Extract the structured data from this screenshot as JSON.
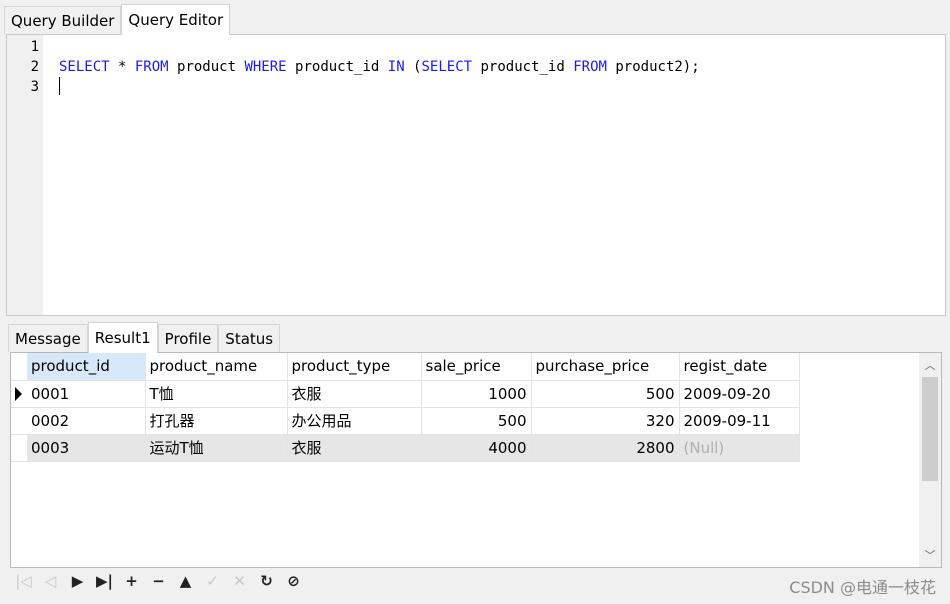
{
  "top_tabs": [
    {
      "label": "Query Builder",
      "active": false
    },
    {
      "label": "Query Editor",
      "active": true
    }
  ],
  "editor": {
    "lines": [
      {
        "num": "1",
        "tokens": []
      },
      {
        "num": "2",
        "tokens": [
          {
            "t": "SELECT",
            "kw": true
          },
          {
            "t": " * "
          },
          {
            "t": "FROM",
            "kw": true
          },
          {
            "t": " product "
          },
          {
            "t": "WHERE",
            "kw": true
          },
          {
            "t": " product_id "
          },
          {
            "t": "IN",
            "kw": true
          },
          {
            "t": " ("
          },
          {
            "t": "SELECT",
            "kw": true
          },
          {
            "t": " product_id "
          },
          {
            "t": "FROM",
            "kw": true
          },
          {
            "t": " product2);"
          }
        ]
      },
      {
        "num": "3",
        "tokens": []
      }
    ]
  },
  "bottom_tabs": [
    {
      "label": "Message",
      "active": false
    },
    {
      "label": "Result1",
      "active": true
    },
    {
      "label": "Profile",
      "active": false
    },
    {
      "label": "Status",
      "active": false
    }
  ],
  "grid": {
    "columns": [
      "product_id",
      "product_name",
      "product_type",
      "sale_price",
      "purchase_price",
      "regist_date"
    ],
    "numeric_columns": [
      3,
      4
    ],
    "selected_header": 0,
    "current_row": 0,
    "highlighted_row": 2,
    "rows": [
      [
        "0001",
        "T恤",
        "衣服",
        "1000",
        "500",
        "2009-09-20"
      ],
      [
        "0002",
        "打孔器",
        "办公用品",
        "500",
        "320",
        "2009-09-11"
      ],
      [
        "0003",
        "运动T恤",
        "衣服",
        "4000",
        "2800",
        "(Null)"
      ]
    ]
  },
  "navbar": [
    {
      "icon": "first-record-icon",
      "glyph": "|◁",
      "enabled": false
    },
    {
      "icon": "prior-record-icon",
      "glyph": "◁",
      "enabled": false
    },
    {
      "icon": "next-record-icon",
      "glyph": "▶",
      "enabled": true
    },
    {
      "icon": "last-record-icon",
      "glyph": "▶|",
      "enabled": true
    },
    {
      "icon": "insert-record-icon",
      "glyph": "+",
      "enabled": true
    },
    {
      "icon": "delete-record-icon",
      "glyph": "−",
      "enabled": true
    },
    {
      "icon": "edit-record-icon",
      "glyph": "▲",
      "enabled": true
    },
    {
      "icon": "apply-changes-icon",
      "glyph": "✓",
      "enabled": false
    },
    {
      "icon": "cancel-changes-icon",
      "glyph": "✕",
      "enabled": false
    },
    {
      "icon": "refresh-icon",
      "glyph": "↻",
      "enabled": true
    },
    {
      "icon": "stop-icon",
      "glyph": "⊘",
      "enabled": true
    }
  ],
  "scrollbar": {
    "up_glyph": "︿",
    "down_glyph": "﹀"
  },
  "watermark": "CSDN @电通一枝花",
  "colors": {
    "keyword": "#1a1aff",
    "header_selected": "#d6e8fa",
    "null_text": "#b0b0b0"
  }
}
